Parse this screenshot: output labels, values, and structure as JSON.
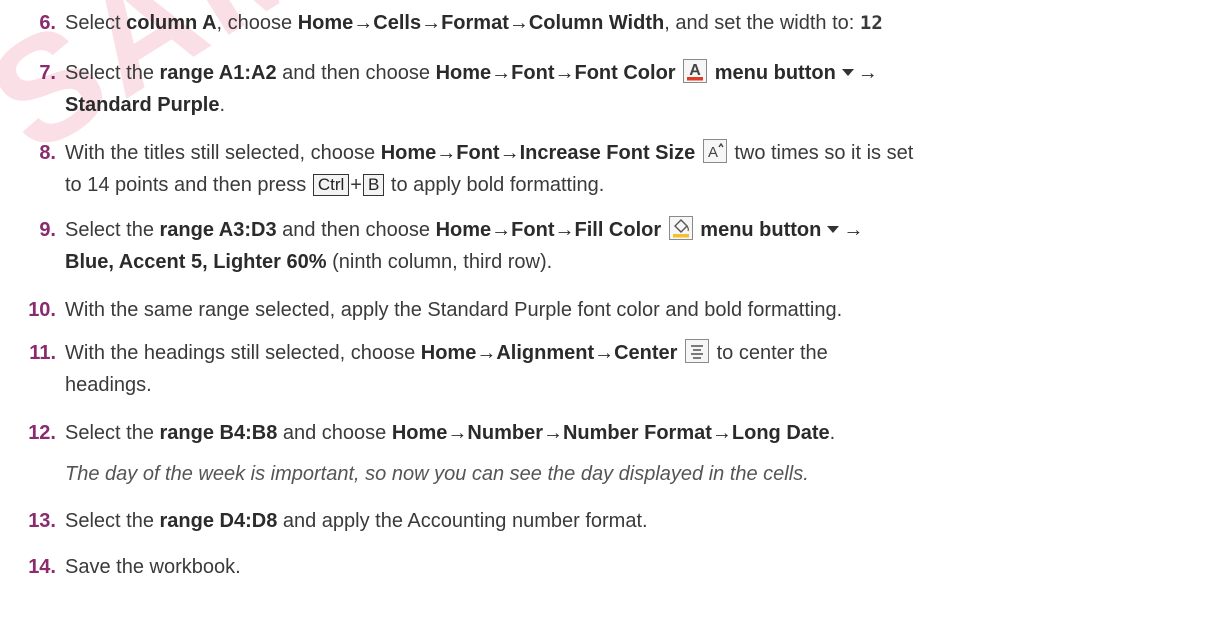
{
  "watermark": "SAMPLE",
  "steps": [
    {
      "num": "6.",
      "t1": "Select ",
      "b1": "column A",
      "t2": ", choose ",
      "b2": "Home→Cells→Format→Column Width",
      "t3": ", and set the width to: ",
      "mono": "12"
    },
    {
      "num": "7.",
      "t1": "Select the ",
      "b1": "range A1:A2",
      "t2": " and then choose ",
      "b2": "Home→Font→Font Color",
      "b3": "menu button",
      "arrow": "→",
      "b4": "Standard Purple",
      "t3": "."
    },
    {
      "num": "8.",
      "t1": "With the titles still selected, choose ",
      "b1": "Home→Font→Increase Font Size",
      "t2": " two times so it is set",
      "t3": "to 14 points and then press ",
      "key1": "Ctrl",
      "plus": "+",
      "key2": "B",
      "t4": " to apply bold formatting."
    },
    {
      "num": "9.",
      "t1": "Select the ",
      "b1": "range A3:D3",
      "t2": " and then choose ",
      "b2": "Home→Font→Fill Color",
      "b3": "menu button",
      "arrow": "→",
      "b4": "Blue, Accent 5, Lighter 60%",
      "t3": " (ninth column, third row)."
    },
    {
      "num": "10.",
      "t1": "With the same range selected, apply the Standard Purple font color and bold formatting."
    },
    {
      "num": "11.",
      "t1": "With the headings still selected, choose ",
      "b1": "Home→Alignment→Center",
      "t2": " to center the",
      "t3": "headings."
    },
    {
      "num": "12.",
      "t1": "Select the ",
      "b1": "range B4:B8",
      "t2": " and choose ",
      "b2": "Home→Number→Number Format→Long Date",
      "t3": ".",
      "note": "The day of the week is important, so now you can see the day displayed in the cells."
    },
    {
      "num": "13.",
      "t1": "Select the ",
      "b1": "range D4:D8",
      "t2": " and apply the Accounting number format."
    },
    {
      "num": "14.",
      "t1": "Save the workbook."
    }
  ],
  "icons": {
    "font_color": "font-color-icon",
    "increase_font": "increase-font-size-icon",
    "fill_color": "fill-color-icon",
    "center": "center-align-icon"
  },
  "colors": {
    "number": "#8a2b6d",
    "font_color_bar": "#e03b24",
    "fill_bar": "#f2c12e",
    "watermark": "#e74c78"
  }
}
